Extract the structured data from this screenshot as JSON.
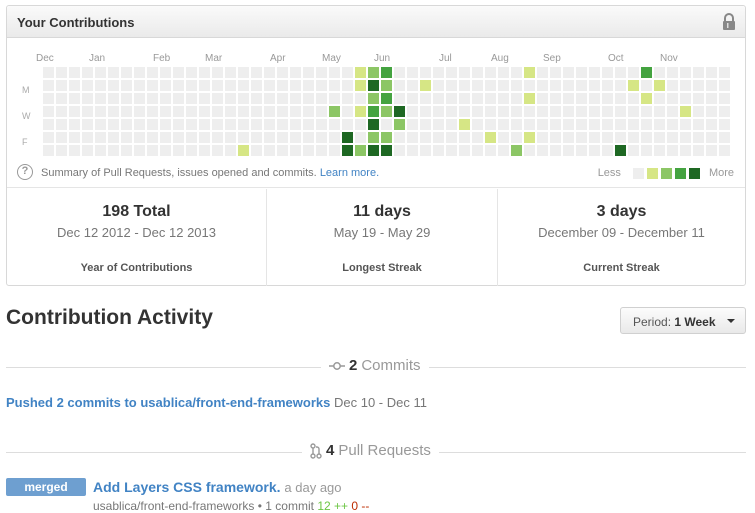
{
  "contributions": {
    "title": "Your Contributions",
    "months": [
      "Dec",
      "Jan",
      "Feb",
      "Mar",
      "Apr",
      "May",
      "Jun",
      "Jul",
      "Aug",
      "Sep",
      "Oct",
      "Nov"
    ],
    "day_labels": [
      "M",
      "W",
      "F"
    ],
    "summary_text": "Summary of Pull Requests, issues opened and commits.",
    "learn_more": "Learn more.",
    "legend_less": "Less",
    "legend_more": "More",
    "legend_colors": [
      "#eeeeee",
      "#d6e685",
      "#8cc665",
      "#44a340",
      "#1e6823"
    ],
    "calendar_cells": [
      {
        "w": 24,
        "d": 0,
        "level": 1
      },
      {
        "w": 24,
        "d": 1,
        "level": 1
      },
      {
        "w": 24,
        "d": 3,
        "level": 1
      },
      {
        "w": 24,
        "d": 6,
        "level": 2
      },
      {
        "w": 25,
        "d": 0,
        "level": 2
      },
      {
        "w": 25,
        "d": 1,
        "level": 4
      },
      {
        "w": 25,
        "d": 2,
        "level": 2
      },
      {
        "w": 25,
        "d": 3,
        "level": 3
      },
      {
        "w": 25,
        "d": 4,
        "level": 4
      },
      {
        "w": 25,
        "d": 5,
        "level": 2
      },
      {
        "w": 25,
        "d": 6,
        "level": 4
      },
      {
        "w": 26,
        "d": 0,
        "level": 3
      },
      {
        "w": 26,
        "d": 1,
        "level": 2
      },
      {
        "w": 26,
        "d": 2,
        "level": 3
      },
      {
        "w": 26,
        "d": 3,
        "level": 2
      },
      {
        "w": 26,
        "d": 5,
        "level": 2
      },
      {
        "w": 26,
        "d": 6,
        "level": 4
      },
      {
        "w": 22,
        "d": 3,
        "level": 2
      },
      {
        "w": 23,
        "d": 5,
        "level": 4
      },
      {
        "w": 23,
        "d": 6,
        "level": 4
      },
      {
        "w": 27,
        "d": 3,
        "level": 4
      },
      {
        "w": 27,
        "d": 4,
        "level": 2
      },
      {
        "w": 29,
        "d": 1,
        "level": 1
      },
      {
        "w": 32,
        "d": 4,
        "level": 1
      },
      {
        "w": 34,
        "d": 5,
        "level": 1
      },
      {
        "w": 36,
        "d": 6,
        "level": 2
      },
      {
        "w": 37,
        "d": 0,
        "level": 1
      },
      {
        "w": 37,
        "d": 2,
        "level": 1
      },
      {
        "w": 37,
        "d": 5,
        "level": 1
      },
      {
        "w": 44,
        "d": 6,
        "level": 4
      },
      {
        "w": 45,
        "d": 1,
        "level": 1
      },
      {
        "w": 46,
        "d": 0,
        "level": 3
      },
      {
        "w": 46,
        "d": 2,
        "level": 1
      },
      {
        "w": 47,
        "d": 1,
        "level": 1
      },
      {
        "w": 49,
        "d": 3,
        "level": 1
      },
      {
        "w": 54,
        "d": 1,
        "level": 1
      },
      {
        "w": 54,
        "d": 2,
        "level": 1
      },
      {
        "w": 54,
        "d": 3,
        "level": 1
      },
      {
        "w": 15,
        "d": 6,
        "level": 1
      }
    ]
  },
  "stats": [
    {
      "big": "198 Total",
      "range": "Dec 12 2012 - Dec 12 2013",
      "label": "Year of Contributions"
    },
    {
      "big": "11 days",
      "range": "May 19 - May 29",
      "label": "Longest Streak"
    },
    {
      "big": "3 days",
      "range": "December 09 - December 11",
      "label": "Current Streak"
    }
  ],
  "activity": {
    "title": "Contribution Activity",
    "period_prefix": "Period:",
    "period_value": "1 Week"
  },
  "commits_section": {
    "count": "2",
    "label": "Commits",
    "push_link": "Pushed 2 commits to usablica/front-end-frameworks",
    "push_dates": "Dec 10 - Dec 11"
  },
  "pulls_section": {
    "count": "4",
    "label": "Pull Requests",
    "badge": "merged",
    "pr_title": "Add Layers CSS framework.",
    "pr_ago": "a day ago",
    "pr_repo": "usablica/front-end-frameworks",
    "pr_commits": "1 commit",
    "pr_additions": "12 ++",
    "pr_deletions": "0 --"
  }
}
